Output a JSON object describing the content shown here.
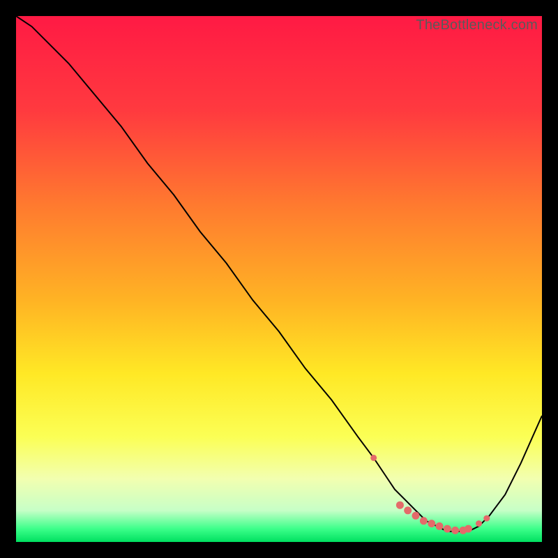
{
  "watermark": "TheBottleneck.com",
  "colors": {
    "bg": "#000000",
    "curve": "#000000",
    "dots": "#e46a6a",
    "gradient_stops": [
      {
        "offset": 0.0,
        "color": "#ff1a44"
      },
      {
        "offset": 0.18,
        "color": "#ff3a3f"
      },
      {
        "offset": 0.36,
        "color": "#ff7a2f"
      },
      {
        "offset": 0.54,
        "color": "#ffb324"
      },
      {
        "offset": 0.68,
        "color": "#ffe825"
      },
      {
        "offset": 0.8,
        "color": "#fbff55"
      },
      {
        "offset": 0.88,
        "color": "#f2ffb0"
      },
      {
        "offset": 0.94,
        "color": "#c7ffc7"
      },
      {
        "offset": 0.975,
        "color": "#3cff8a"
      },
      {
        "offset": 1.0,
        "color": "#00e060"
      }
    ]
  },
  "chart_data": {
    "type": "line",
    "title": "",
    "xlabel": "",
    "ylabel": "",
    "xlim": [
      0,
      100
    ],
    "ylim": [
      0,
      100
    ],
    "series": [
      {
        "name": "curve",
        "x": [
          0,
          3,
          6,
          10,
          15,
          20,
          25,
          30,
          35,
          40,
          45,
          50,
          55,
          60,
          65,
          68,
          70,
          72,
          74,
          76,
          78,
          80,
          82,
          84,
          86,
          88,
          90,
          93,
          96,
          100
        ],
        "y": [
          100,
          98,
          95,
          91,
          85,
          79,
          72,
          66,
          59,
          53,
          46,
          40,
          33,
          27,
          20,
          16,
          13,
          10,
          8,
          6,
          4,
          3,
          2,
          2,
          2,
          3,
          5,
          9,
          15,
          24
        ]
      }
    ],
    "marker_points": {
      "name": "dots",
      "x": [
        68,
        73,
        74.5,
        76,
        77.5,
        79,
        80.5,
        82,
        83.5,
        85,
        86,
        88,
        89.5
      ],
      "y": [
        16,
        7,
        6,
        5,
        4,
        3.5,
        3,
        2.5,
        2.2,
        2.2,
        2.5,
        3.5,
        4.5
      ]
    }
  }
}
